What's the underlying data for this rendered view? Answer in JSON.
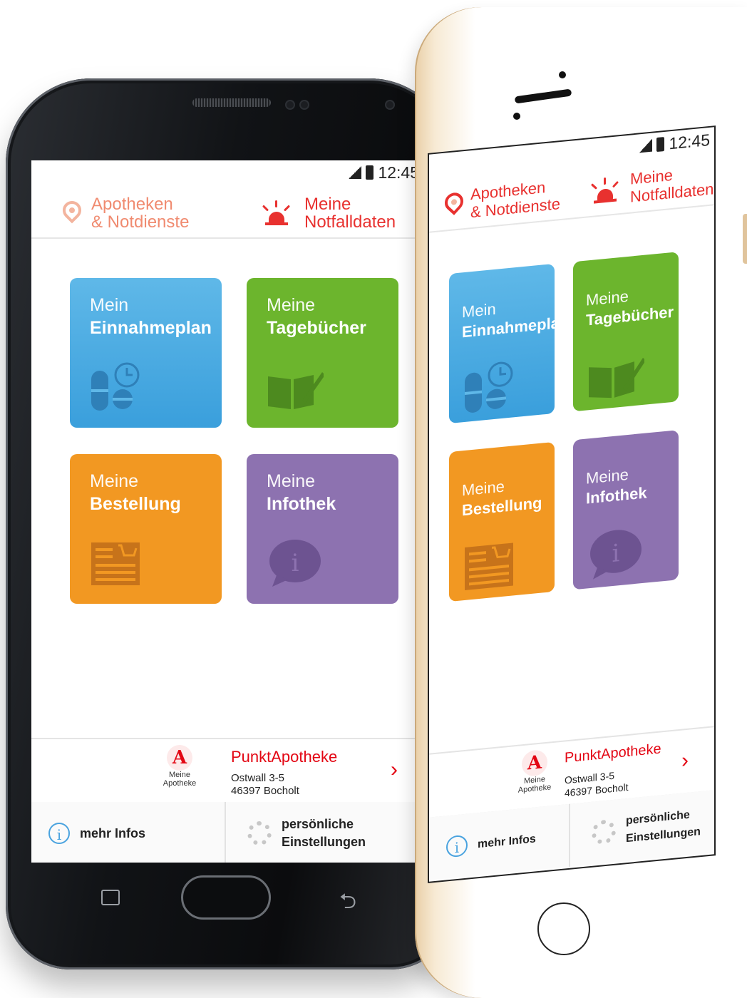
{
  "status": {
    "time": "12:45"
  },
  "nav": {
    "pharmacies_line1": "Apotheken",
    "pharmacies_line2": "& Notdienste",
    "emergency_line1": "Meine",
    "emergency_line2": "Notfalldaten"
  },
  "tiles": [
    {
      "line1": "Mein",
      "line2": "Einnahmeplan",
      "icon": "pill-clock-icon",
      "color": "#3a9fdc"
    },
    {
      "line1": "Meine",
      "line2": "Tagebücher",
      "icon": "book-pen-icon",
      "color": "#6cb52d"
    },
    {
      "line1": "Meine",
      "line2": "Bestellung",
      "icon": "order-list-cart-icon",
      "color": "#f29822"
    },
    {
      "line1": "Meine",
      "line2": "Infothek",
      "icon": "info-bubble-icon",
      "color": "#8d72b0"
    }
  ],
  "pharmacy": {
    "logo_caption_1": "Meine",
    "logo_caption_2": "Apotheke",
    "name": "PunktApotheke",
    "address_line1": "Ostwall 3-5",
    "address_line2": "46397 Bocholt"
  },
  "bottom": {
    "more_info": "mehr Infos",
    "settings_line1": "persönliche",
    "settings_line2": "Einstellungen"
  }
}
